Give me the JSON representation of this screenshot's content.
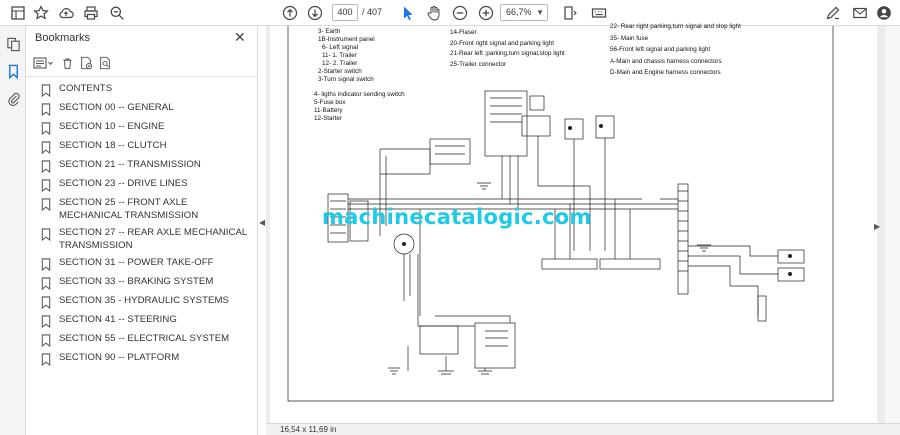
{
  "toolbar": {
    "page_current": "400",
    "page_total": "/ 407",
    "zoom": "66,7%"
  },
  "bookmarks": {
    "title": "Bookmarks",
    "items": [
      {
        "label": "CONTENTS"
      },
      {
        "label": "SECTION 00 -- GENERAL"
      },
      {
        "label": "SECTION 10 -- ENGINE"
      },
      {
        "label": "SECTION 18 -- CLUTCH"
      },
      {
        "label": "SECTION 21 -- TRANSMISSION"
      },
      {
        "label": "SECTION 23 -- DRIVE LINES"
      },
      {
        "label": "SECTION 25 -- FRONT AXLE MECHANICAL TRANSMISSION"
      },
      {
        "label": "SECTION 27 -- REAR AXLE MECHANICAL TRANSMISSION"
      },
      {
        "label": "SECTION 31 -- POWER TAKE-OFF"
      },
      {
        "label": "SECTION 33 -- BRAKING SYSTEM"
      },
      {
        "label": "SECTION 35 - HYDRAULIC SYSTEMS"
      },
      {
        "label": "SECTION 41 -- STEERING"
      },
      {
        "label": "SECTION 55 -- ELECTRICAL SYSTEM"
      },
      {
        "label": "SECTION 90 -- PLATFORM"
      }
    ]
  },
  "document": {
    "legend_left": [
      "3- Earth",
      "1B-Instrument panel",
      "6- Left signal",
      "11- 1. Trailer",
      "12- 2. Trailer",
      "2-Starter switch",
      "3-Turn signal switch"
    ],
    "legend_left2": [
      "4-  ligths indicator sending switch",
      "5-Fuse box",
      "11-Battery",
      "12-Starter"
    ],
    "legend_mid": [
      "14-Flaser",
      "20-Front right signal and parking  light",
      "21-Rear left ;parking,turn signal,stop light",
      "25-Trailer connector"
    ],
    "legend_right": [
      "22- Rear right parking,turn signal and stop light",
      "35- Main fuse",
      "56-Front left signal and parking  light",
      "A-Main and chassis harness connectors",
      "D-Main and Engine harness connectors"
    ],
    "watermark": "machinecatalogic.com"
  },
  "status": {
    "page_size": "16,54 x 11,69 in"
  },
  "colors": {
    "accent_blue": "#1a73e8",
    "watermark": "#1ecbe6"
  }
}
